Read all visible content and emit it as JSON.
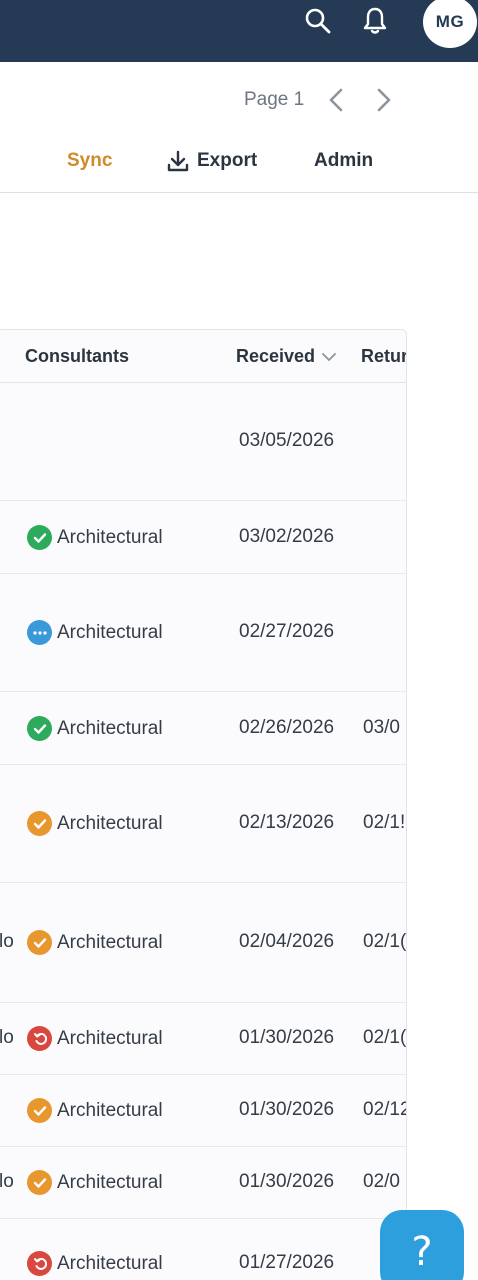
{
  "header": {
    "avatar_initials": "MG",
    "search_icon": "search-icon",
    "bell_icon": "bell-icon"
  },
  "toolbar": {
    "page_label": "Page 1",
    "sync_label": "Sync",
    "export_label": "Export",
    "admin_label": "Admin",
    "sync_color": "#d08a2a"
  },
  "table": {
    "columns": {
      "consultants": "Consultants",
      "received": "Received",
      "returned": "Retur"
    },
    "rows": [
      {
        "lead": "",
        "status": "",
        "consultant": "",
        "received": "03/05/2026",
        "returned": ""
      },
      {
        "lead": "",
        "status": "approved",
        "consultant": "Architectural",
        "received": "03/02/2026",
        "returned": ""
      },
      {
        "lead": "",
        "status": "pending",
        "consultant": "Architectural",
        "received": "02/27/2026",
        "returned": ""
      },
      {
        "lead": "",
        "status": "approved",
        "consultant": "Architectural",
        "received": "02/26/2026",
        "returned": "03/0"
      },
      {
        "lead": "",
        "status": "approved-notes",
        "consultant": "Architectural",
        "received": "02/13/2026",
        "returned": "02/1!"
      },
      {
        "lead": "lo",
        "status": "approved-notes",
        "consultant": "Architectural",
        "received": "02/04/2026",
        "returned": "02/1("
      },
      {
        "lead": "lo",
        "status": "revise",
        "consultant": "Architectural",
        "received": "01/30/2026",
        "returned": "02/1("
      },
      {
        "lead": "",
        "status": "approved-notes",
        "consultant": "Architectural",
        "received": "01/30/2026",
        "returned": "02/12"
      },
      {
        "lead": "lo",
        "status": "approved-notes",
        "consultant": "Architectural",
        "received": "01/30/2026",
        "returned": "02/0"
      },
      {
        "lead": "",
        "status": "revise",
        "consultant": "Architectural",
        "received": "01/27/2026",
        "returned": ""
      }
    ]
  },
  "colors": {
    "topbar": "#243a55",
    "approved": "#2eaa5c",
    "pending": "#3a9ad9",
    "approved_notes": "#e8962e",
    "revise": "#d9473f"
  },
  "help": {
    "label": "?"
  }
}
